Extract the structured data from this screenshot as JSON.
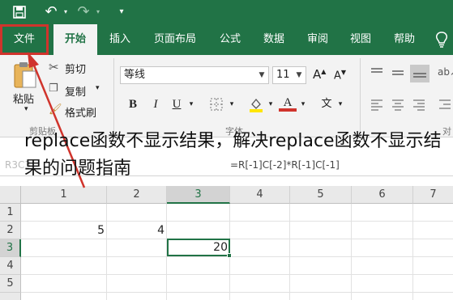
{
  "quick_access": {
    "save_icon": "save-icon",
    "undo_icon": "undo-icon",
    "redo_icon": "redo-icon",
    "customize_icon": "customize-icon"
  },
  "tabs": [
    {
      "label": "文件"
    },
    {
      "label": "开始"
    },
    {
      "label": "插入"
    },
    {
      "label": "页面布局"
    },
    {
      "label": "公式"
    },
    {
      "label": "数据"
    },
    {
      "label": "审阅"
    },
    {
      "label": "视图"
    },
    {
      "label": "帮助"
    }
  ],
  "clipboard": {
    "paste_label": "粘贴",
    "cut_label": "剪切",
    "copy_label": "复制",
    "format_painter_label": "格式刷",
    "group_label": "剪贴板"
  },
  "font": {
    "font_name": "等线",
    "font_size": "11",
    "bold": "B",
    "italic": "I",
    "underline": "U",
    "grow": "A",
    "shrink": "A",
    "color_a": "A",
    "wen": "文",
    "group_label": "字体"
  },
  "align_group_label": "对",
  "formula_bar": {
    "name_box": "R3C3",
    "formula": "=R[-1]C[-2]*R[-1]C[-1]"
  },
  "grid": {
    "columns": [
      "1",
      "2",
      "3",
      "4",
      "5",
      "6",
      "7"
    ],
    "rows": [
      "1",
      "2",
      "3",
      "4",
      "5"
    ],
    "cells": {
      "r2c1": "5",
      "r2c2": "4",
      "r3c3": "20"
    }
  },
  "caption": "replace函数不显示结果，解决replace函数不显示结果的问题指南",
  "colors": {
    "accent": "#217346",
    "highlight": "#d0342c"
  }
}
